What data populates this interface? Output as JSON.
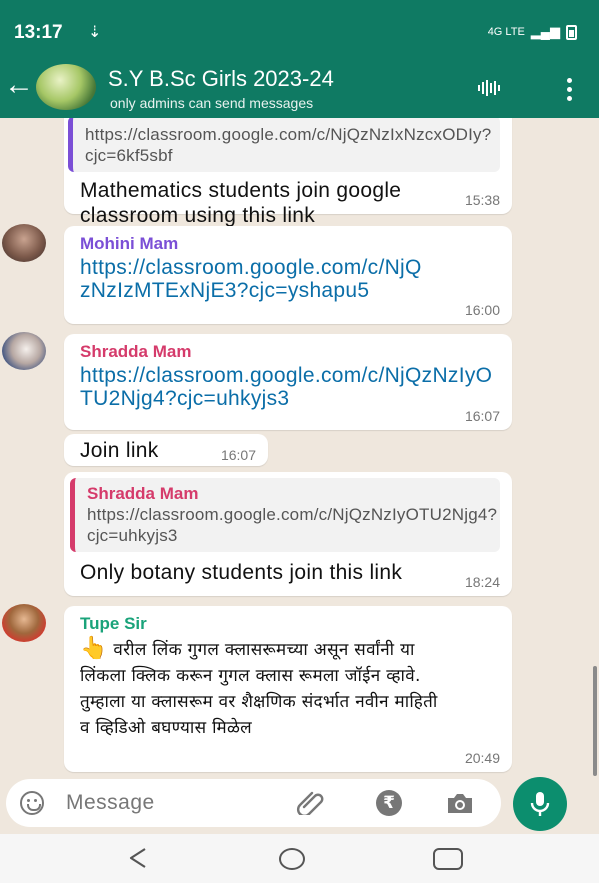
{
  "status_bar": {
    "time": "13:17",
    "download_glyph": "⇣",
    "network": "4G LTE",
    "signal": "▂▄▆",
    "icons": [
      "download-icon",
      "signal-icon",
      "battery-icon"
    ]
  },
  "header": {
    "title": "S.Y B.Sc Girls 2023-24",
    "subtitle": "only admins can send messages",
    "back_glyph": "←",
    "icons": [
      "back-arrow-icon",
      "group-avatar",
      "voice-chat-icon",
      "more-options-icon"
    ]
  },
  "messages": [
    {
      "quoted_link": "https://classroom.google.com/c/NjQzNzIxNzcxODIy?cjc=6kf5sbf",
      "text": "Mathematics students join google classroom using this link",
      "time": "15:38"
    },
    {
      "sender": "Mohini Mam",
      "sender_color": "#7b4fd6",
      "link": "https://classroom.google.com/c/NjQzNzIzMTExNjE3?cjc=yshapu5",
      "time": "16:00"
    },
    {
      "sender": "Shradda Mam",
      "sender_color": "#d53b6b",
      "link": "https://classroom.google.com/c/NjQzNzIyOTU2Njg4?cjc=uhkyjs3",
      "time": "16:07"
    },
    {
      "text": "Join link",
      "time": "16:07"
    },
    {
      "quoted_sender": "Shradda Mam",
      "quoted_link": "https://classroom.google.com/c/NjQzNzIyOTU2Njg4?cjc=uhkyjs3",
      "text": "Only botany students join this link",
      "time": "18:24"
    },
    {
      "sender": "Tupe Sir",
      "sender_color": "#1aa37a",
      "emoji": "👆",
      "text": "वरील लिंक गुगल क्लासरूमच्या असून सर्वांनी या लिंकला क्लिक करून गुगल क्लास रूमला जॉईन व्हावे. तुम्हाला या क्लासरूम वर शैक्षणिक संदर्भात नवीन माहिती व व्हिडिओ बघण्यास मिळेल",
      "time": "20:49"
    }
  ],
  "input": {
    "placeholder": "Message",
    "rupee_glyph": "₹",
    "icons": [
      "emoji-icon",
      "attach-icon",
      "payment-icon",
      "camera-icon",
      "mic-icon"
    ]
  },
  "navigation": {
    "icons": [
      "back-icon",
      "home-icon",
      "recent-apps-icon"
    ]
  },
  "colors": {
    "header": "#0f7a63",
    "chat_background": "#efe7dd",
    "link": "#0b6ea8",
    "mic_button": "#0c8e6e",
    "quote_border_group": "#7b4fd6",
    "quote_border_shradda": "#d53b6b"
  }
}
